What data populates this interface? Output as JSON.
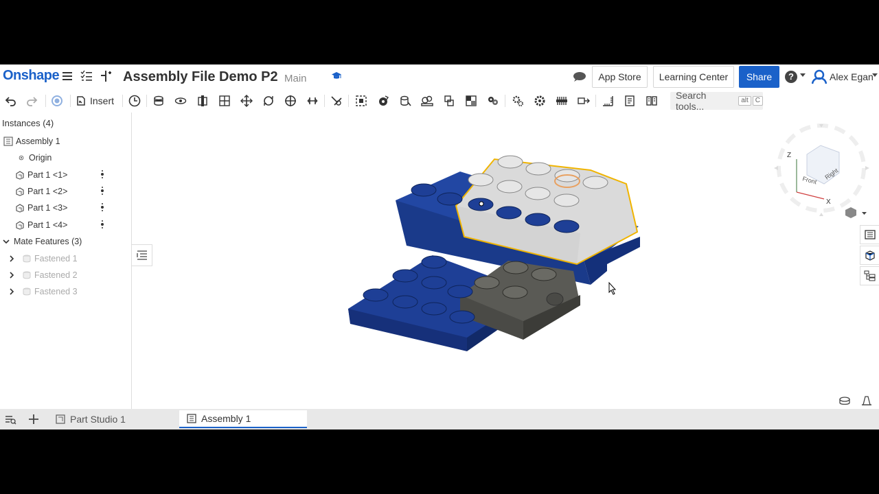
{
  "header": {
    "logo": "Onshape",
    "doc_title": "Assembly File Demo P2",
    "branch": "Main",
    "app_store": "App Store",
    "learning_center": "Learning Center",
    "share": "Share",
    "help": "?",
    "user_name": "Alex Egan"
  },
  "toolbar": {
    "insert_label": "Insert",
    "search_placeholder": "Search tools...",
    "search_shortcut_1": "alt",
    "search_shortcut_2": "C"
  },
  "feature_list": {
    "instances_title": "Instances (4)",
    "assembly": "Assembly 1",
    "origin": "Origin",
    "parts": [
      "Part 1 <1>",
      "Part 1 <2>",
      "Part 1 <3>",
      "Part 1 <4>"
    ],
    "mates_title": "Mate Features (3)",
    "mates": [
      "Fastened 1",
      "Fastened 2",
      "Fastened 3"
    ]
  },
  "view_cube": {
    "axis_z": "Z",
    "axis_x": "X",
    "face_front": "Front",
    "face_right": "Right"
  },
  "tabs": [
    {
      "label": "Part Studio 1",
      "active": false
    },
    {
      "label": "Assembly 1",
      "active": true
    }
  ],
  "colors": {
    "brand": "#1a61c9",
    "brick_blue": "#1e3f96",
    "brick_white": "#dcdcdc",
    "brick_gray": "#5a5a55",
    "selection": "#f0b400"
  }
}
